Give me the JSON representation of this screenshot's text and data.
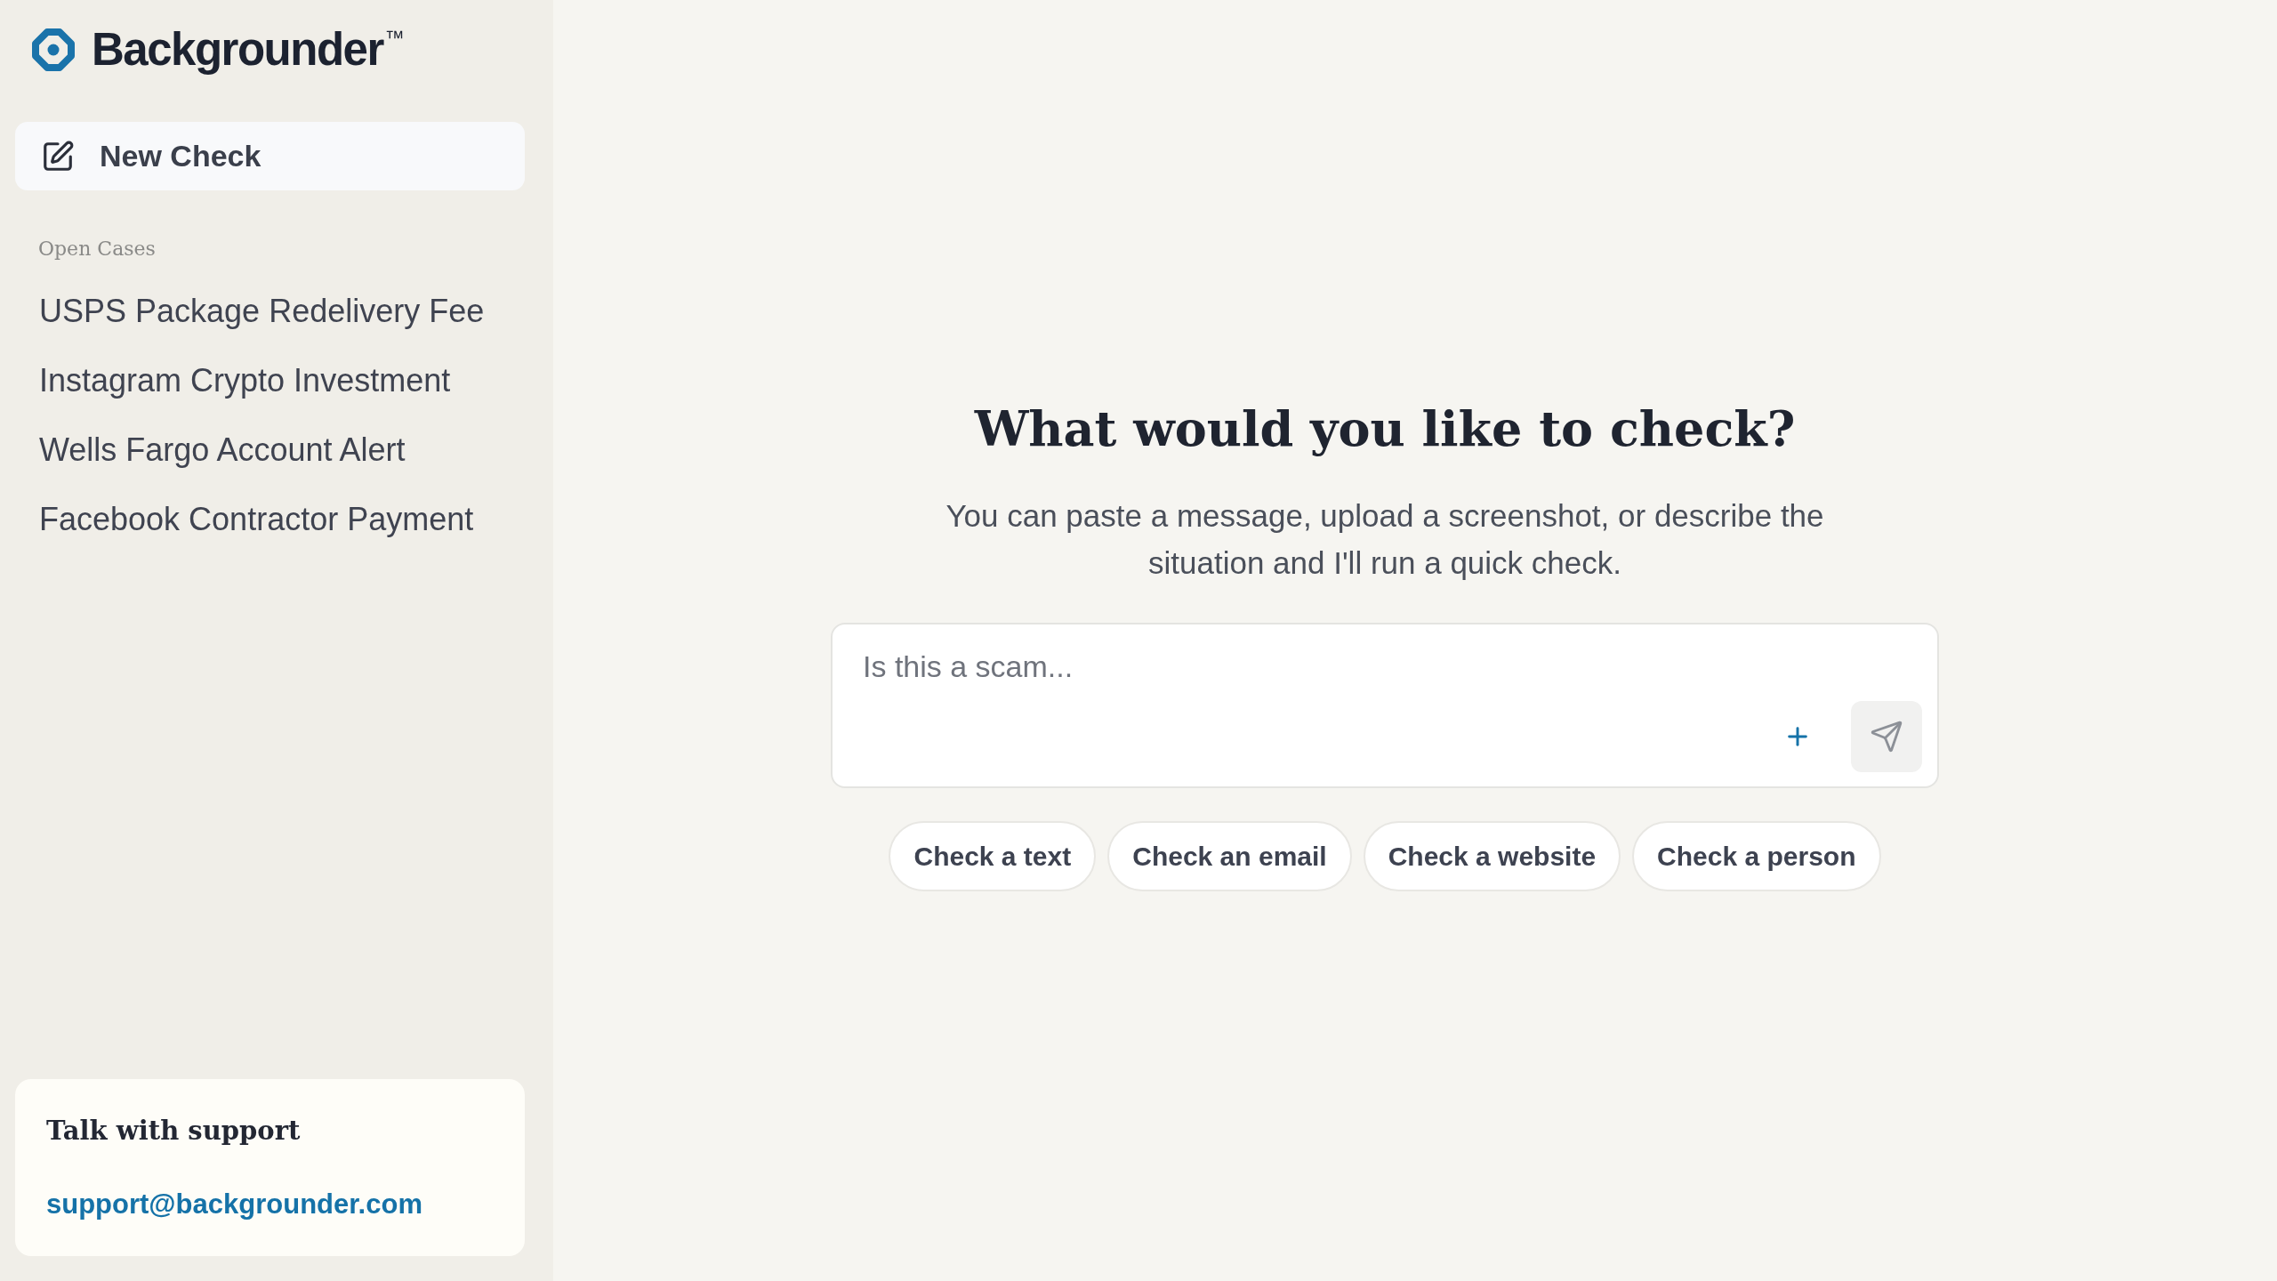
{
  "sidebar": {
    "logo": {
      "name": "Backgrounder",
      "trademark": "™"
    },
    "new_check_button": {
      "label": "New Check"
    },
    "open_cases": {
      "heading": "Open Cases",
      "items": [
        {
          "label": "USPS Package Redelivery Fee",
          "selected": false
        },
        {
          "label": "Instagram Crypto Investment",
          "selected": false
        },
        {
          "label": "Wells Fargo Account Alert",
          "selected": false
        },
        {
          "label": "Facebook Contractor Payment",
          "selected": false
        }
      ]
    },
    "support_card": {
      "title": "Talk with support",
      "email": "support@backgrounder.com"
    }
  },
  "main": {
    "heading": "What would you like to check?",
    "subtitle": "You can paste a message, upload a screenshot, or describe the situation and I'll run a quick check.",
    "composer": {
      "placeholder": "Is this a scam...",
      "send_button": {
        "disabled": true
      }
    },
    "suggestions": [
      "Check a text",
      "Check an email",
      "Check a website",
      "Check a person"
    ]
  }
}
